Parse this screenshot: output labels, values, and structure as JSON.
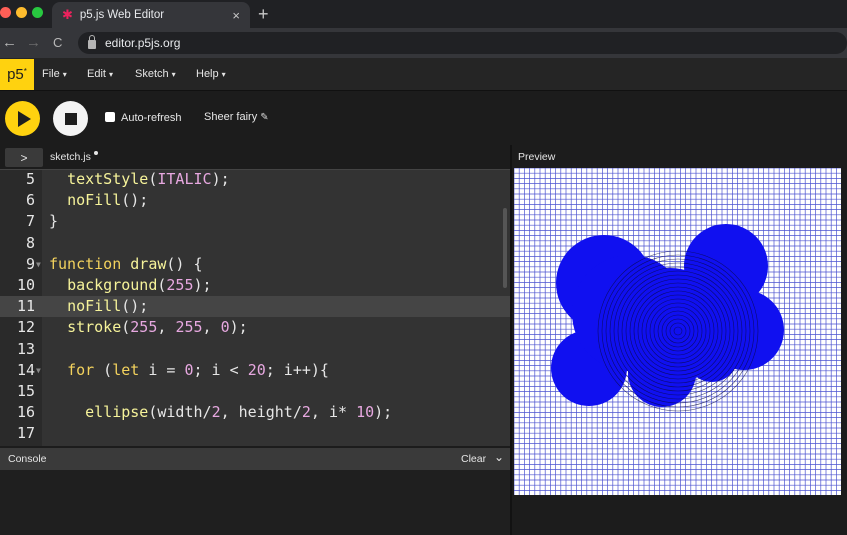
{
  "browser": {
    "tab_title": "p5.js Web Editor",
    "tab_close": "×",
    "new_tab": "+",
    "back_icon": "←",
    "forward_icon": "→",
    "reload_icon": "C",
    "url": "editor.p5js.org"
  },
  "menubar": {
    "logo_text": "p5",
    "logo_mark": "*",
    "items": [
      {
        "label": "File",
        "caret": "▾"
      },
      {
        "label": "Edit",
        "caret": "▾"
      },
      {
        "label": "Sketch",
        "caret": "▾"
      },
      {
        "label": "Help",
        "caret": "▾"
      }
    ]
  },
  "toolbar": {
    "auto_refresh_label": "Auto-refresh",
    "auto_refresh_checked": false,
    "sketch_name": "Sheer fairy",
    "edit_icon": "✎"
  },
  "files": {
    "expand_icon": ">",
    "active_file": "sketch.js"
  },
  "editor": {
    "active_line": 11,
    "lines": [
      {
        "n": "5",
        "text": "  textStyle(ITALIC);"
      },
      {
        "n": "6",
        "text": "  noFill();"
      },
      {
        "n": "7",
        "text": "}"
      },
      {
        "n": "8",
        "text": ""
      },
      {
        "n": "9",
        "text": "function draw() {"
      },
      {
        "n": "10",
        "text": "  background(255);"
      },
      {
        "n": "11",
        "text": "  noFill();"
      },
      {
        "n": "12",
        "text": "  stroke(255, 255, 0);"
      },
      {
        "n": "13",
        "text": ""
      },
      {
        "n": "14",
        "text": "  for (let i = 0; i < 20; i++){"
      },
      {
        "n": "15",
        "text": ""
      },
      {
        "n": "16",
        "text": "    ellipse(width/2, height/2, i* 10);"
      },
      {
        "n": "17",
        "text": ""
      }
    ]
  },
  "console": {
    "label": "Console",
    "clear_label": "Clear",
    "collapse_icon": "⌄"
  },
  "preview": {
    "label": "Preview",
    "background_color": "#ffffff",
    "grid_color": "#2d35c8",
    "blob_color": "#1010f0",
    "ring_color": "#0a0a40"
  },
  "colors": {
    "p5_yellow": "#ffd20f",
    "p5_pink": "#ed225d",
    "editor_bg": "#333333",
    "active_line_bg": "#454545"
  }
}
